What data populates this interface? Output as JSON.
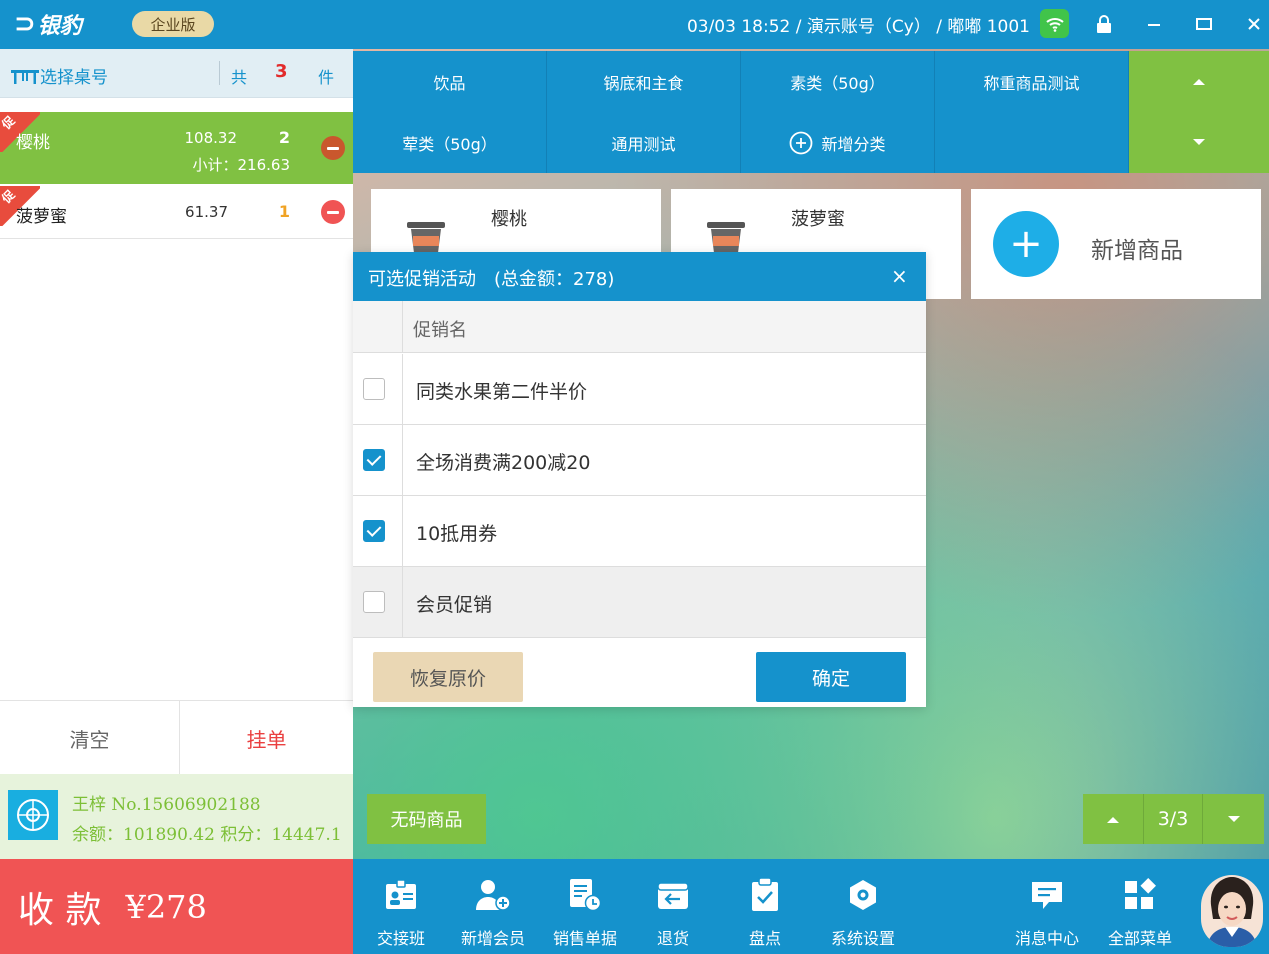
{
  "app": {
    "logo_text": "银豹",
    "edition": "企业版",
    "top_info": "03/03 18:52 / 演示账号（Cy） / 嘟嘟 1001",
    "colors": {
      "primary": "#1592cc",
      "green": "#80c142",
      "red": "#f05454",
      "badge": "#e9d9a6"
    }
  },
  "left": {
    "header": {
      "select_table": "选择桌号",
      "total_prefix": "共",
      "total_count": "3",
      "total_suffix": "件"
    },
    "order_items": [
      {
        "promo_tag": "促",
        "name": "樱桃",
        "price": "108.32",
        "qty": "2",
        "subtotal": "小计：216.63"
      },
      {
        "promo_tag": "促",
        "name": "菠萝蜜",
        "price": "61.37",
        "qty": "1"
      }
    ],
    "clear_label": "清空",
    "hold_label": "挂单",
    "member": {
      "line1": "王梓 No.15606902188",
      "line2": "余额：101890.42 积分：14447.1"
    },
    "pay": {
      "label": "收 款",
      "amount": "¥278"
    }
  },
  "categories": {
    "row1": [
      "饮品",
      "锅底和主食",
      "素类（50g）",
      "称重商品测试"
    ],
    "row2": [
      "荤类（50g）",
      "通用测试",
      "新增分类"
    ]
  },
  "products": [
    {
      "name": "樱桃"
    },
    {
      "name": "菠萝蜜"
    }
  ],
  "add_product_label": "新增商品",
  "promo_dialog": {
    "title": "可选促销活动　(总金额：278)",
    "close": "×",
    "column_header": "促销名",
    "rows": [
      {
        "name": "同类水果第二件半价",
        "checked": false
      },
      {
        "name": "全场消费满200减20",
        "checked": true
      },
      {
        "name": "10抵用券",
        "checked": true
      },
      {
        "name": "会员促销",
        "checked": false
      }
    ],
    "restore_label": "恢复原价",
    "confirm_label": "确定"
  },
  "no_code_label": "无码商品",
  "pager": {
    "text": "3/3"
  },
  "toolbar": [
    {
      "label": "交接班",
      "icon": "shift-icon"
    },
    {
      "label": "新增会员",
      "icon": "add-member-icon"
    },
    {
      "label": "销售单据",
      "icon": "sales-doc-icon"
    },
    {
      "label": "退货",
      "icon": "return-icon"
    },
    {
      "label": "盘点",
      "icon": "inventory-icon"
    },
    {
      "label": "系统设置",
      "icon": "settings-icon"
    },
    {
      "label": "消息中心",
      "icon": "message-icon"
    },
    {
      "label": "全部菜单",
      "icon": "all-menu-icon"
    }
  ]
}
